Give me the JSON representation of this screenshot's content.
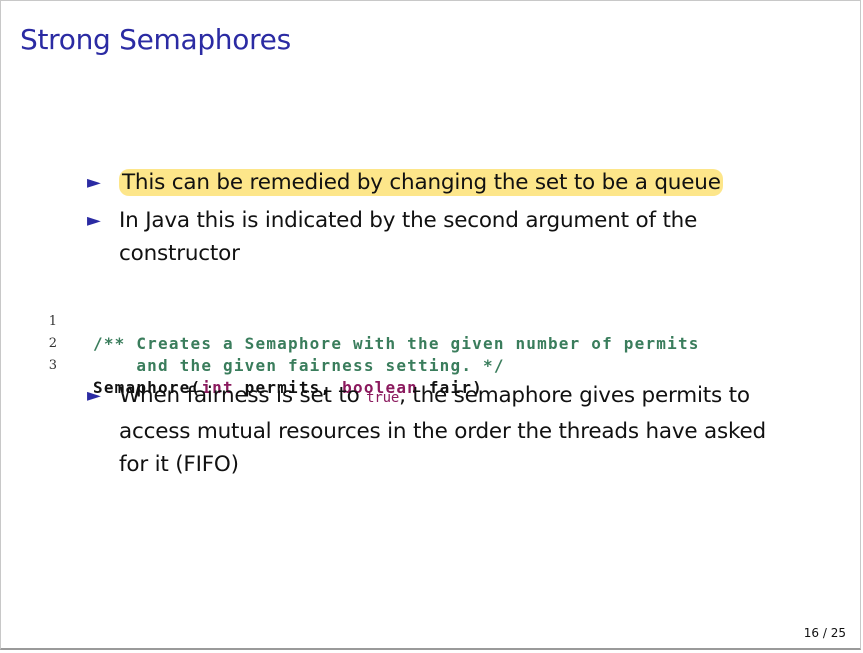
{
  "slide": {
    "title": "Strong Semaphores",
    "bullets_top": [
      {
        "marker": "►",
        "text": "This can be remedied by changing the set to be a queue",
        "highlighted": true
      },
      {
        "marker": "►",
        "text": "In Java this is indicated by the second argument of the constructor"
      }
    ],
    "code": {
      "lines": [
        {
          "num": "1",
          "comment": "/** Creates a Semaphore with the given number of permits"
        },
        {
          "num": "2",
          "comment": "    and the given fairness setting. */"
        },
        {
          "num": "3",
          "segments": [
            "Semaphore(",
            "int",
            " permits, ",
            "boolean",
            " fair)"
          ]
        }
      ]
    },
    "bullet_bottom": {
      "marker": "►",
      "before": "When fairness is set to ",
      "code": "true",
      "after": ", the semaphore gives permits to access mutual resources in the order the threads have asked for it (FIFO)"
    },
    "page": "16 / 25"
  },
  "colors": {
    "title": "#2b2ba3",
    "highlight": "#fde68a",
    "comment": "#3a7d5c",
    "keyword": "#8b1a5e"
  }
}
